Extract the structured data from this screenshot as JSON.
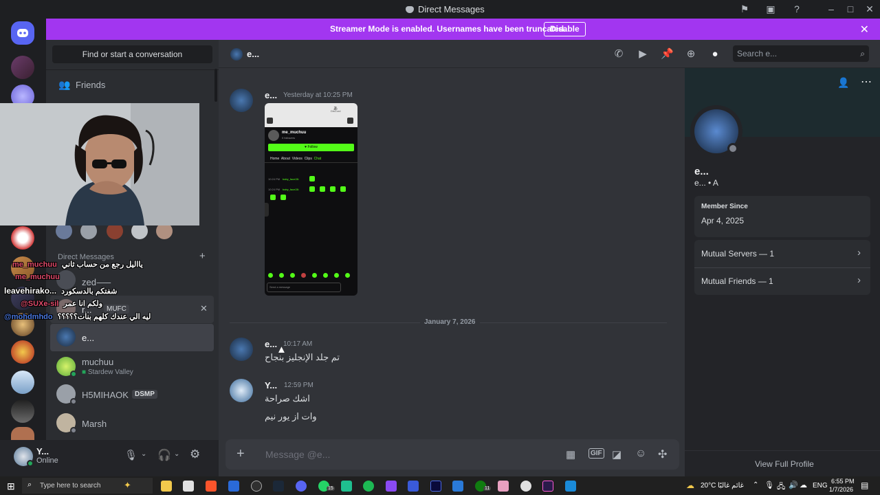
{
  "window": {
    "title": "Direct Messages"
  },
  "banner": {
    "text": "Streamer Mode is enabled. Usernames have been truncated.",
    "button": "Disable"
  },
  "sidebar": {
    "find": "Find or start a conversation",
    "friends": "Friends",
    "section_title": "Direct Messages",
    "items": [
      {
        "name": "zed⸺",
        "sub": ""
      },
      {
        "name": "r...",
        "badge": "MUFC"
      },
      {
        "name": "e...",
        "sub": ""
      },
      {
        "name": "muchuu",
        "sub": "Stardew Valley"
      },
      {
        "name": "H5MIHAOK",
        "badge": "DSMP"
      },
      {
        "name": "Marsh",
        "sub": ""
      }
    ]
  },
  "user_panel": {
    "name": "Y...",
    "status": "Online"
  },
  "chat_header": {
    "name": "e...",
    "search_placeholder": "Search e..."
  },
  "messages": {
    "m1": {
      "author": "e...",
      "time": "Yesterday at 10:25 PM"
    },
    "divider": "January 7, 2026",
    "m2": {
      "author": "e...",
      "time": "10:17 AM",
      "text": "تم جلد الإنجليز بنجاح"
    },
    "m3": {
      "author": "Y...",
      "time": "12:59 PM",
      "line1": "اشك صراحة",
      "line2": "وات از يور نيم"
    }
  },
  "attachment": {
    "username": "me_muchuu",
    "followers": "0 followers",
    "follow": "Follow",
    "tabs": [
      "Home",
      "About",
      "Videos",
      "Clips",
      "Chat"
    ],
    "chat1_time": "10:24 PM",
    "chat1_user": "baby_face28:",
    "chat2_time": "10:24 PM",
    "chat2_user": "baby_face28:",
    "send": "Send a message",
    "top_tag": "DisCord",
    "top_glyph": "あ"
  },
  "composer": {
    "placeholder": "Message @e..."
  },
  "profile": {
    "name": "e...",
    "sub": "e... • A",
    "member_since_label": "Member Since",
    "member_since": "Apr 4, 2025",
    "mutual_servers": "Mutual Servers — 1",
    "mutual_friends": "Mutual Friends — 1",
    "view_full": "View Full Profile"
  },
  "overlay_chat": [
    {
      "user": "me_muchuu",
      "text": "يااليل رجع من حساب ثاني"
    },
    {
      "user": "me_muchuu",
      "text": ""
    },
    {
      "user": "leavehirako...",
      "text": "شفتكم بالدسكورد"
    },
    {
      "user": "@SUXe-sil",
      "text": "ولكم انا عمر"
    },
    {
      "user": "@mohdmhdo",
      "text": "ليه الي عندك كلهم بنات؟؟؟؟؟"
    }
  ],
  "taskbar": {
    "search": "Type here to search",
    "temp": "20°C",
    "weather": "غائم غالبًا",
    "lang": "ENG",
    "time": "6:55 PM",
    "date": "1/7/2026",
    "badge_whatsapp": "15",
    "badge_xbox": "11"
  },
  "colors": {
    "banner": "#a236f0",
    "online": "#23a55a",
    "accent": "#5865f2"
  }
}
